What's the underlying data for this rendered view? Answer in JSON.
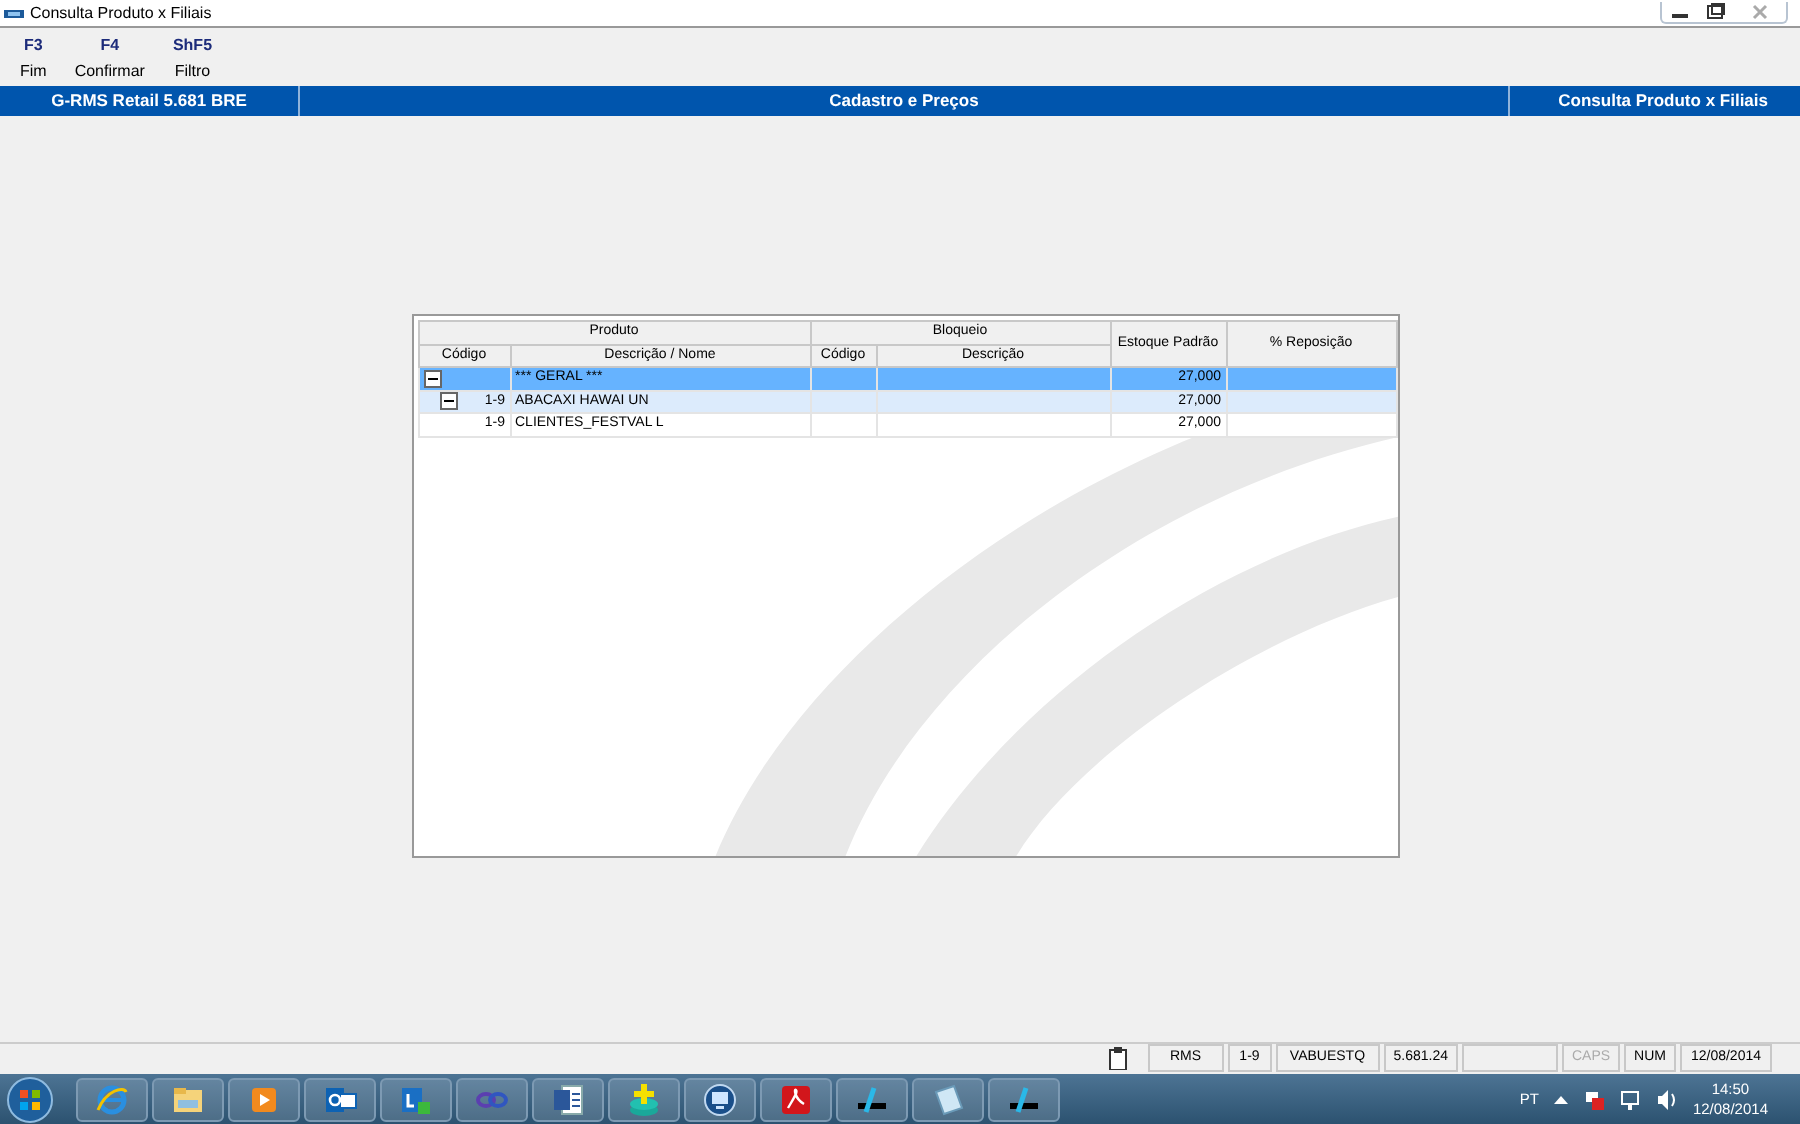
{
  "window": {
    "title": "Consulta Produto x Filiais"
  },
  "toolbar": [
    {
      "key": "F3",
      "label": "Fim"
    },
    {
      "key": "F4",
      "label": "Confirmar"
    },
    {
      "key": "ShF5",
      "label": "Filtro"
    }
  ],
  "header_bar": [
    "G-RMS Retail 5.681 BRE",
    "Cadastro e Preços",
    "Consulta Produto x Filiais"
  ],
  "grid": {
    "headers": [
      {
        "label": "Produto",
        "columns": [
          "Código",
          "Descrição / Nome"
        ]
      },
      {
        "label": "Bloqueio",
        "columns": [
          "Código",
          "Descrição"
        ]
      },
      {
        "label": "Estoque Padrão"
      },
      {
        "label": "% Reposição"
      }
    ],
    "rows": [
      {
        "selected": true,
        "expanded": true,
        "description": "*** GERAL ***",
        "stock": "27,000",
        "children": [
          {
            "selected": false,
            "highlighted": true,
            "expanded": true,
            "code": "1-9",
            "description": "ABACAXI HAWAI UN",
            "stock": "27,000",
            "children": [
              {
                "selected": false,
                "highlighted": false,
                "code": "1-9",
                "description": "CLIENTES_FESTVAL L",
                "stock": "27,000"
              }
            ]
          }
        ]
      }
    ]
  },
  "status_bar": [
    {
      "kind": "text",
      "text": "RMS",
      "on": true
    },
    {
      "kind": "text",
      "text": "1-9",
      "on": true
    },
    {
      "kind": "text",
      "text": "VABUESTQ",
      "on": true
    },
    {
      "kind": "text",
      "text": "5.681.24",
      "on": true
    },
    {
      "kind": "blank"
    },
    {
      "kind": "text",
      "text": "CAPS",
      "on": false
    },
    {
      "kind": "text",
      "text": "NUM",
      "on": true
    },
    {
      "kind": "text",
      "text": "12/08/2014",
      "on": true
    }
  ],
  "tray": {
    "language": "PT",
    "time": "14:50",
    "date": "12/08/2014"
  }
}
